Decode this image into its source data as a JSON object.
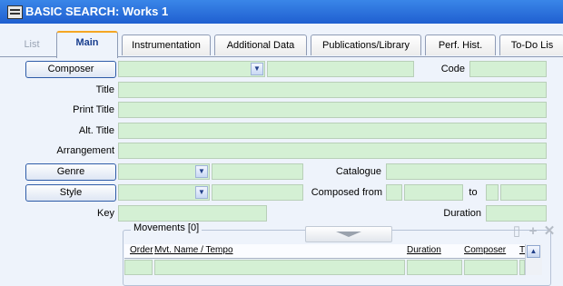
{
  "window": {
    "title": "BASIC SEARCH: Works  1"
  },
  "tabs": [
    {
      "label": "List"
    },
    {
      "label": "Main"
    },
    {
      "label": "Instrumentation"
    },
    {
      "label": "Additional Data"
    },
    {
      "label": "Publications/Library"
    },
    {
      "label": "Perf. Hist."
    },
    {
      "label": "To-Do Lis"
    }
  ],
  "form": {
    "composer_button": "Composer",
    "code_label": "Code",
    "title_label": "Title",
    "print_title_label": "Print Title",
    "alt_title_label": "Alt. Title",
    "arrangement_label": "Arrangement",
    "genre_button": "Genre",
    "catalogue_label": "Catalogue",
    "style_button": "Style",
    "composed_from_label": "Composed from",
    "to_label": "to",
    "key_label": "Key",
    "duration_label": "Duration"
  },
  "movements": {
    "label": "Movements  [0]",
    "columns": [
      "Order",
      "Mvt. Name / Tempo",
      "Duration",
      "Composer",
      "T"
    ]
  },
  "colors": {
    "field_bg": "#d4f0d4",
    "titlebar": "#2a70dc",
    "tab_accent": "#f5a623"
  }
}
